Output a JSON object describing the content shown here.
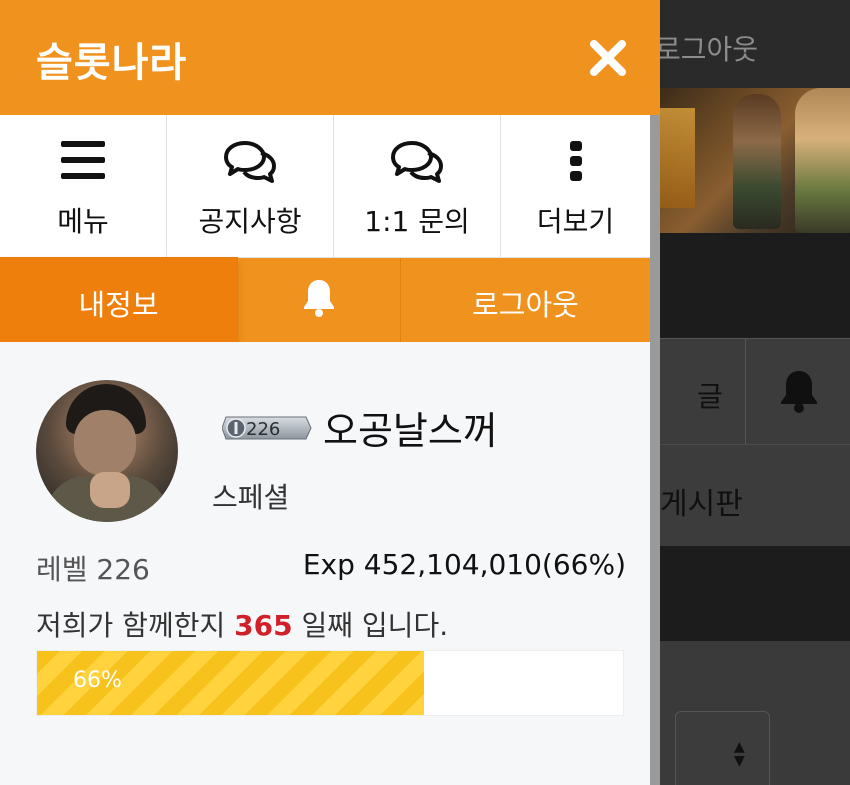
{
  "background": {
    "top_right_label": "로그아웃",
    "row_partial_text": "글",
    "board_partial_text": "게시판",
    "colors": {
      "overlay": "#1c1c1c",
      "panel": "#3c3c3c"
    }
  },
  "header": {
    "title": "슬롯나라",
    "close_icon": "close-icon",
    "color": "#f0921e"
  },
  "quick_menu": [
    {
      "id": "menu",
      "icon": "hamburger-icon",
      "label": "메뉴"
    },
    {
      "id": "notice",
      "icon": "chat-bubbles-icon",
      "label": "공지사항"
    },
    {
      "id": "inquiry",
      "icon": "chat-bubbles-icon",
      "label": "1:1 문의"
    },
    {
      "id": "more",
      "icon": "vertical-dots-icon",
      "label": "더보기"
    }
  ],
  "tabs": {
    "my_info": "내정보",
    "notifications_icon": "bell-icon",
    "logout": "로그아웃",
    "active": "my_info"
  },
  "profile": {
    "level_badge": "226",
    "nickname": "오공날스꺼",
    "grade": "스페셜",
    "level_text": "레벨 226",
    "exp_text": "Exp 452,104,010(66%)",
    "days_prefix": "저희가 함께한지",
    "days_count": "365",
    "days_suffix": "일째 입니다.",
    "progress": 0.66,
    "progress_label": "66%",
    "colors": {
      "days_count": "#d0202a",
      "progress": "#f7c21c"
    }
  }
}
